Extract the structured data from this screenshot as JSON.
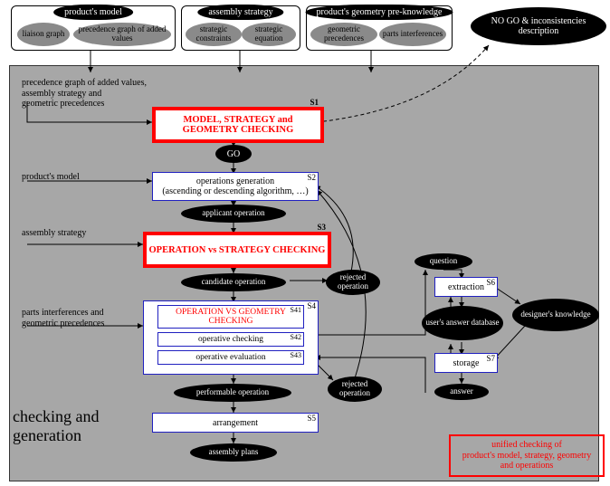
{
  "top_groups": {
    "model": {
      "title": "product's model",
      "items": [
        "liaison graph",
        "precedence graph of added values"
      ]
    },
    "strategy": {
      "title": "assembly strategy",
      "items": [
        "strategic constraints",
        "strategic equation"
      ]
    },
    "geometry": {
      "title": "product's geometry pre-knowledge",
      "items": [
        "geometric precedences",
        "parts interferences"
      ]
    }
  },
  "nogo": "NO GO & inconsistencies description",
  "designer": "designer's knowledge",
  "main": {
    "label": "checking and generation",
    "s1": {
      "text": "MODEL,  STRATEGY and GEOMETRY CHECKING",
      "tag": "S1",
      "go": "GO"
    },
    "annot1": "precedence graph of added values,\nassembly strategy and\ngeometric precedences",
    "s2": {
      "text": "operations generation\n(ascending or descending algorithm, …)",
      "tag": "S2",
      "in": "product's model",
      "out": "applicant operation"
    },
    "s3": {
      "text": "OPERATION vs STRATEGY CHECKING",
      "tag": "S3",
      "in": "assembly strategy",
      "out": "candidate operation",
      "rej": "rejected operation"
    },
    "s4": {
      "tag": "S4",
      "s41": {
        "text": "OPERATION VS GEOMETRY CHECKING",
        "tag": "S41"
      },
      "s42": {
        "text": "operative checking",
        "tag": "S42"
      },
      "s43": {
        "text": "operative evaluation",
        "tag": "S43"
      },
      "in": "parts interferences and geometric precedences",
      "out": "performable operation",
      "rej": "rejected operation"
    },
    "s5": {
      "text": "arrangement",
      "tag": "S5",
      "out": "assembly plans"
    },
    "s6": {
      "text": "extraction",
      "tag": "S6",
      "in": "question",
      "out": "user's answer database"
    },
    "s7": {
      "text": "storage",
      "tag": "S7",
      "out": "answer"
    }
  },
  "legend": "unified checking of\nproduct's model, strategy, geometry\nand operations"
}
